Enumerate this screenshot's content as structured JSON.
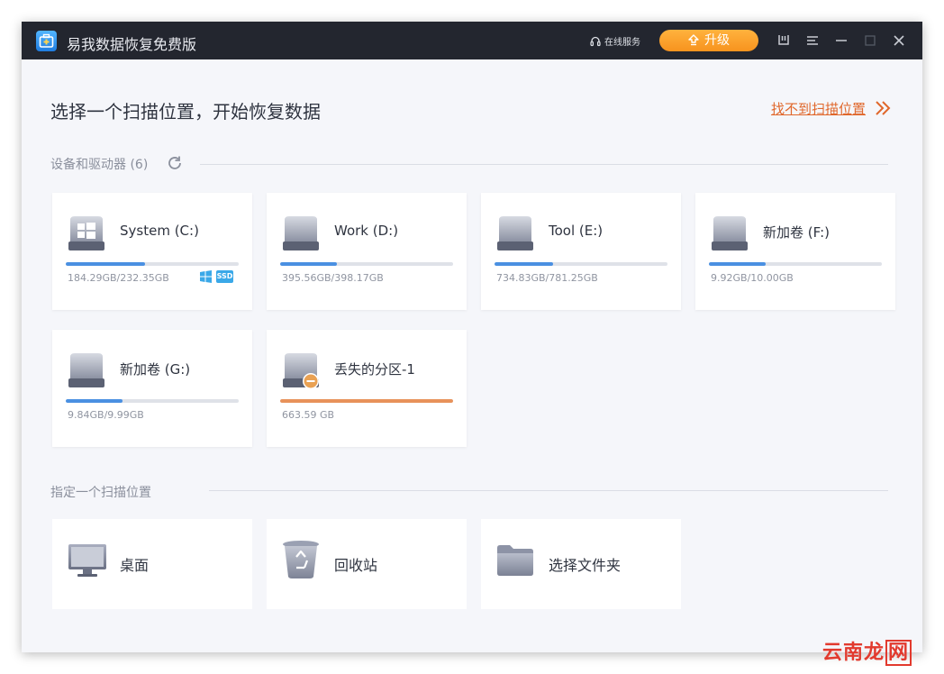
{
  "window": {
    "title": "易我数据恢复免费版",
    "online_service": "在线服务",
    "upgrade": "升级",
    "controls": [
      "download-icon",
      "menu-icon",
      "minimize-icon",
      "maximize-icon",
      "close-icon"
    ]
  },
  "main": {
    "title": "选择一个扫描位置，开始恢复数据",
    "not_found_link": "找不到扫描位置"
  },
  "devices": {
    "section_label": "设备和驱动器",
    "count": "(6)",
    "items": [
      {
        "name": "System (C:)",
        "size": "184.29GB/232.35GB",
        "used_fraction": 0.46,
        "icon": "windows-drive-icon",
        "badges": [
          "windows-icon",
          "SSD"
        ]
      },
      {
        "name": "Work (D:)",
        "size": "395.56GB/398.17GB",
        "used_fraction": 0.33,
        "icon": "hard-drive-icon"
      },
      {
        "name": "Tool (E:)",
        "size": "734.83GB/781.25GB",
        "used_fraction": 0.34,
        "icon": "hard-drive-icon"
      },
      {
        "name": "新加卷 (F:)",
        "size": "9.92GB/10.00GB",
        "used_fraction": 0.33,
        "icon": "hard-drive-icon"
      },
      {
        "name": "新加卷 (G:)",
        "size": "9.84GB/9.99GB",
        "used_fraction": 0.33,
        "icon": "hard-drive-icon"
      },
      {
        "name": "丢失的分区-1",
        "size": "663.59 GB",
        "used_fraction": 1.0,
        "icon": "lost-partition-icon"
      }
    ]
  },
  "locations": {
    "section_label": "指定一个扫描位置",
    "items": [
      {
        "name": "桌面",
        "icon": "desktop-monitor-icon"
      },
      {
        "name": "回收站",
        "icon": "recycle-bin-icon"
      },
      {
        "name": "选择文件夹",
        "icon": "folder-icon"
      }
    ]
  },
  "watermark": {
    "text": "云南龙",
    "last_char": "网"
  },
  "colors": {
    "titlebar": "#23262f",
    "accent_orange": "#f7931e",
    "link": "#e0672b",
    "progress_blue": "#4a90e2",
    "progress_lost": "#e8925a",
    "ssd_badge": "#3aa8e8"
  }
}
